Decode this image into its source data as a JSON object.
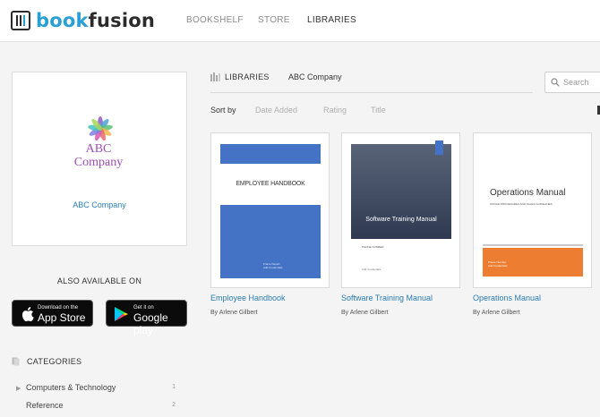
{
  "brand": {
    "part1": "book",
    "part2": "fusion"
  },
  "nav": {
    "bookshelf": "BOOKSHELF",
    "store": "STORE",
    "libraries": "LIBRARIES"
  },
  "library": {
    "logo_line1": "ABC",
    "logo_line2": "Company",
    "name": "ABC Company"
  },
  "also_available": "ALSO AVAILABLE ON",
  "stores": {
    "apple_small": "Download on the",
    "apple_big": "App Store",
    "google_small": "Get it on",
    "google_big": "Google play"
  },
  "categories": {
    "title": "CATEGORIES",
    "items": [
      {
        "label": "Computers & Technology",
        "count": "1"
      },
      {
        "label": "Reference",
        "count": "2"
      }
    ]
  },
  "breadcrumb": {
    "libraries": "LIBRARIES",
    "company": "ABC Company"
  },
  "search": {
    "placeholder": "Search"
  },
  "sort": {
    "label": "Sort by",
    "date": "Date Added",
    "rating": "Rating",
    "title": "Title"
  },
  "books": [
    {
      "title": "Employee Handbook",
      "author": "By Arlene Gilbert",
      "cover_text": "EMPLOYEE HANDBOOK",
      "cover_small1": "Frame Depart",
      "cover_small2": "Add Credentials"
    },
    {
      "title": "Software Training Manual",
      "author": "By Arlene Gilbert",
      "cover_text": "Software Training Manual",
      "cover_small1": "PHONE NUMBER",
      "cover_small2": "Add Credentials"
    },
    {
      "title": "Operations Manual",
      "author": "By Arlene Gilbert",
      "cover_text": "Operations Manual",
      "cover_small1": "OFFICE PROCEDURES AND SALES GUIDELINES",
      "cover_small2": "Phone Number",
      "cover_small3": "Add Credentials"
    }
  ],
  "colors": {
    "accent": "#2a9fd6",
    "link": "#2a7db3",
    "cover_blue": "#4472c4",
    "cover_orange": "#ed7d31",
    "logo_purple": "#9b4fb4"
  },
  "icons": {
    "logo": "book-spine-logo-icon",
    "flower": "flower-logo-icon",
    "apple": "apple-icon",
    "play": "google-play-icon",
    "search": "search-icon",
    "libraries": "libraries-icon",
    "categories": "tag-icon"
  }
}
